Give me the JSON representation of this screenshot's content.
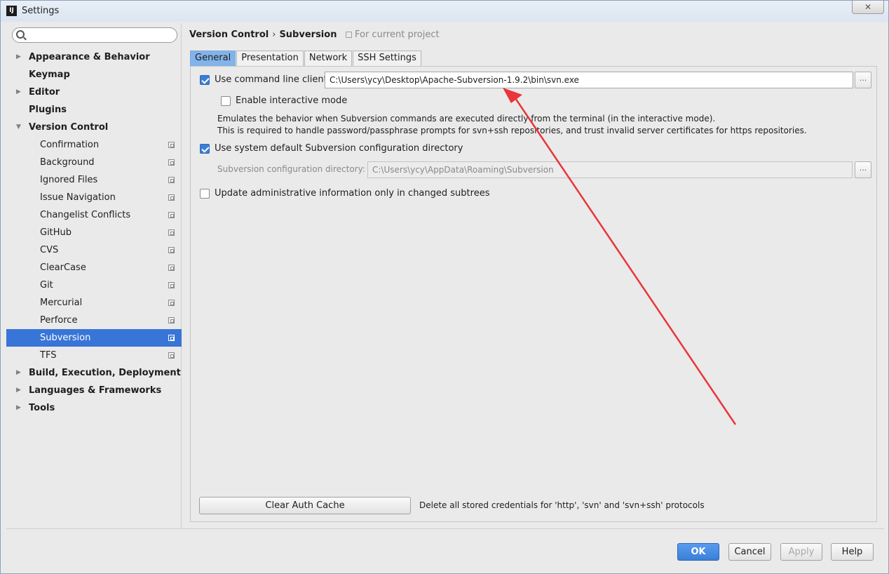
{
  "window": {
    "title": "Settings",
    "close_glyph": "✕"
  },
  "search": {
    "placeholder": "",
    "value": ""
  },
  "sidebar": {
    "items": [
      {
        "label": "Appearance & Behavior",
        "level": 0,
        "expandable": true,
        "expanded": false
      },
      {
        "label": "Keymap",
        "level": 0,
        "expandable": false
      },
      {
        "label": "Editor",
        "level": 0,
        "expandable": true,
        "expanded": false
      },
      {
        "label": "Plugins",
        "level": 0,
        "expandable": false
      },
      {
        "label": "Version Control",
        "level": 0,
        "expandable": true,
        "expanded": true
      },
      {
        "label": "Confirmation",
        "level": 1
      },
      {
        "label": "Background",
        "level": 1
      },
      {
        "label": "Ignored Files",
        "level": 1
      },
      {
        "label": "Issue Navigation",
        "level": 1
      },
      {
        "label": "Changelist Conflicts",
        "level": 1
      },
      {
        "label": "GitHub",
        "level": 1
      },
      {
        "label": "CVS",
        "level": 1
      },
      {
        "label": "ClearCase",
        "level": 1
      },
      {
        "label": "Git",
        "level": 1
      },
      {
        "label": "Mercurial",
        "level": 1
      },
      {
        "label": "Perforce",
        "level": 1
      },
      {
        "label": "Subversion",
        "level": 1,
        "selected": true
      },
      {
        "label": "TFS",
        "level": 1
      },
      {
        "label": "Build, Execution, Deployment",
        "level": 0,
        "expandable": true,
        "expanded": false
      },
      {
        "label": "Languages & Frameworks",
        "level": 0,
        "expandable": true,
        "expanded": false
      },
      {
        "label": "Tools",
        "level": 0,
        "expandable": true,
        "expanded": false
      }
    ]
  },
  "breadcrumb": {
    "parent": "Version Control",
    "separator": "›",
    "current": "Subversion",
    "scope": "For current project"
  },
  "tabs": [
    {
      "label": "General",
      "active": true
    },
    {
      "label": "Presentation"
    },
    {
      "label": "Network"
    },
    {
      "label": "SSH Settings"
    }
  ],
  "general": {
    "use_cmd_client": {
      "label": "Use command line client:",
      "checked": true,
      "value": "C:\\Users\\ycy\\Desktop\\Apache-Subversion-1.9.2\\bin\\svn.exe"
    },
    "interactive_mode": {
      "label": "Enable interactive mode",
      "checked": false,
      "desc_line1": "Emulates the behavior when Subversion commands are executed directly from the terminal (in the interactive mode).",
      "desc_line2": "This is required to handle password/passphrase prompts for svn+ssh repositories, and trust invalid server certificates for https repositories."
    },
    "use_default_config": {
      "label": "Use system default Subversion configuration directory",
      "checked": true
    },
    "config_dir": {
      "label": "Subversion configuration directory:",
      "value": "C:\\Users\\ycy\\AppData\\Roaming\\Subversion"
    },
    "update_admin_info": {
      "label": "Update administrative information only in changed subtrees",
      "checked": false
    },
    "browse_label": "...",
    "clear_auth": {
      "button": "Clear Auth Cache",
      "desc": "Delete all stored credentials for 'http', 'svn' and 'svn+ssh' protocols"
    }
  },
  "footer": {
    "ok": "OK",
    "cancel": "Cancel",
    "apply": "Apply",
    "help": "Help"
  },
  "colors": {
    "selection": "#3875d7",
    "annotation_arrow": "#e8363a",
    "active_tab": "#82b4ea"
  }
}
